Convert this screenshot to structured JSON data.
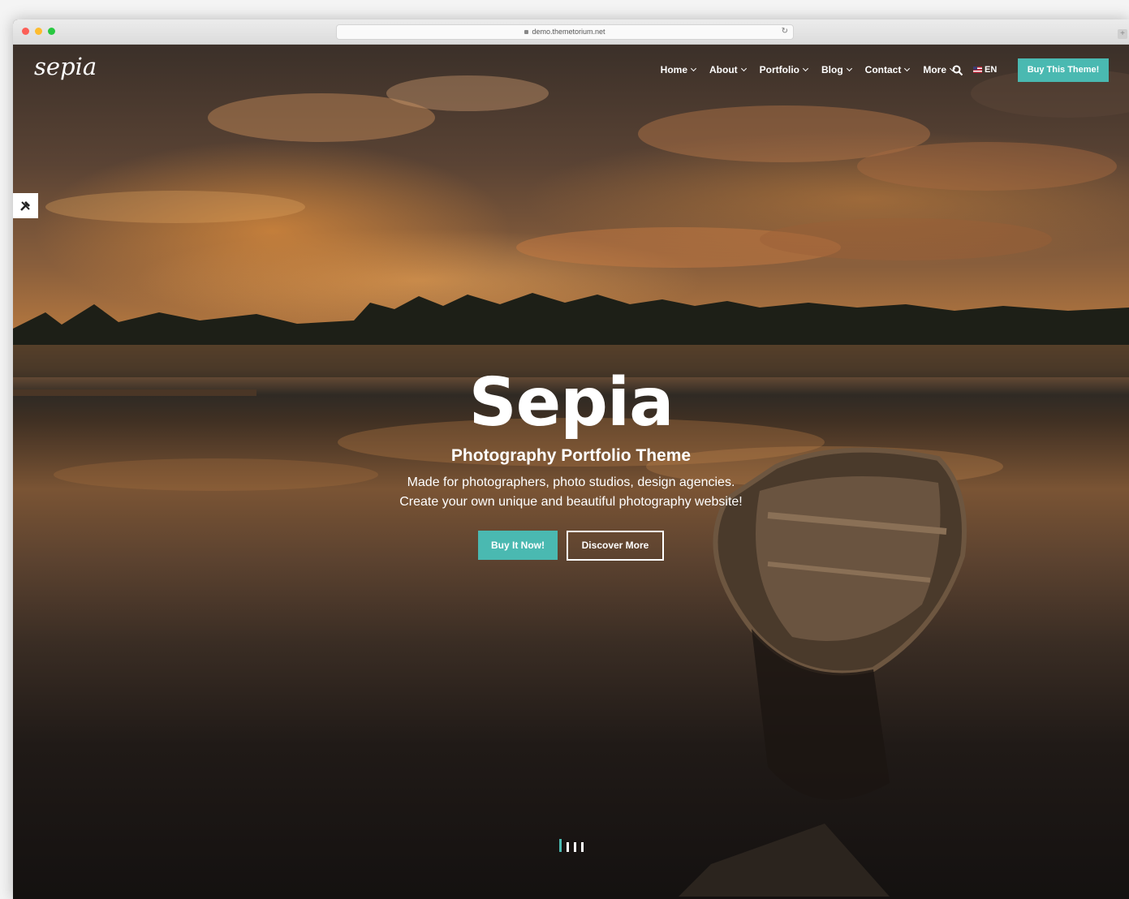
{
  "browser": {
    "url": "demo.themetorium.net"
  },
  "site": {
    "logo": "sepia",
    "nav": [
      {
        "label": "Home"
      },
      {
        "label": "About"
      },
      {
        "label": "Portfolio"
      },
      {
        "label": "Blog"
      },
      {
        "label": "Contact"
      },
      {
        "label": "More"
      }
    ],
    "language": "EN",
    "buy_theme_label": "Buy This Theme!"
  },
  "hero": {
    "title": "Sepia",
    "subtitle": "Photography Portfolio Theme",
    "description_line1": "Made for photographers, photo studios, design agencies.",
    "description_line2": "Create your own unique and beautiful photography website!",
    "primary_button": "Buy It Now!",
    "secondary_button": "Discover More",
    "slides_total": 4,
    "active_slide": 1
  },
  "colors": {
    "accent": "#4ab9b1",
    "text": "#ffffff"
  },
  "icons": {
    "search": "search-icon",
    "tools": "tools-icon",
    "flag": "us-flag-icon"
  }
}
